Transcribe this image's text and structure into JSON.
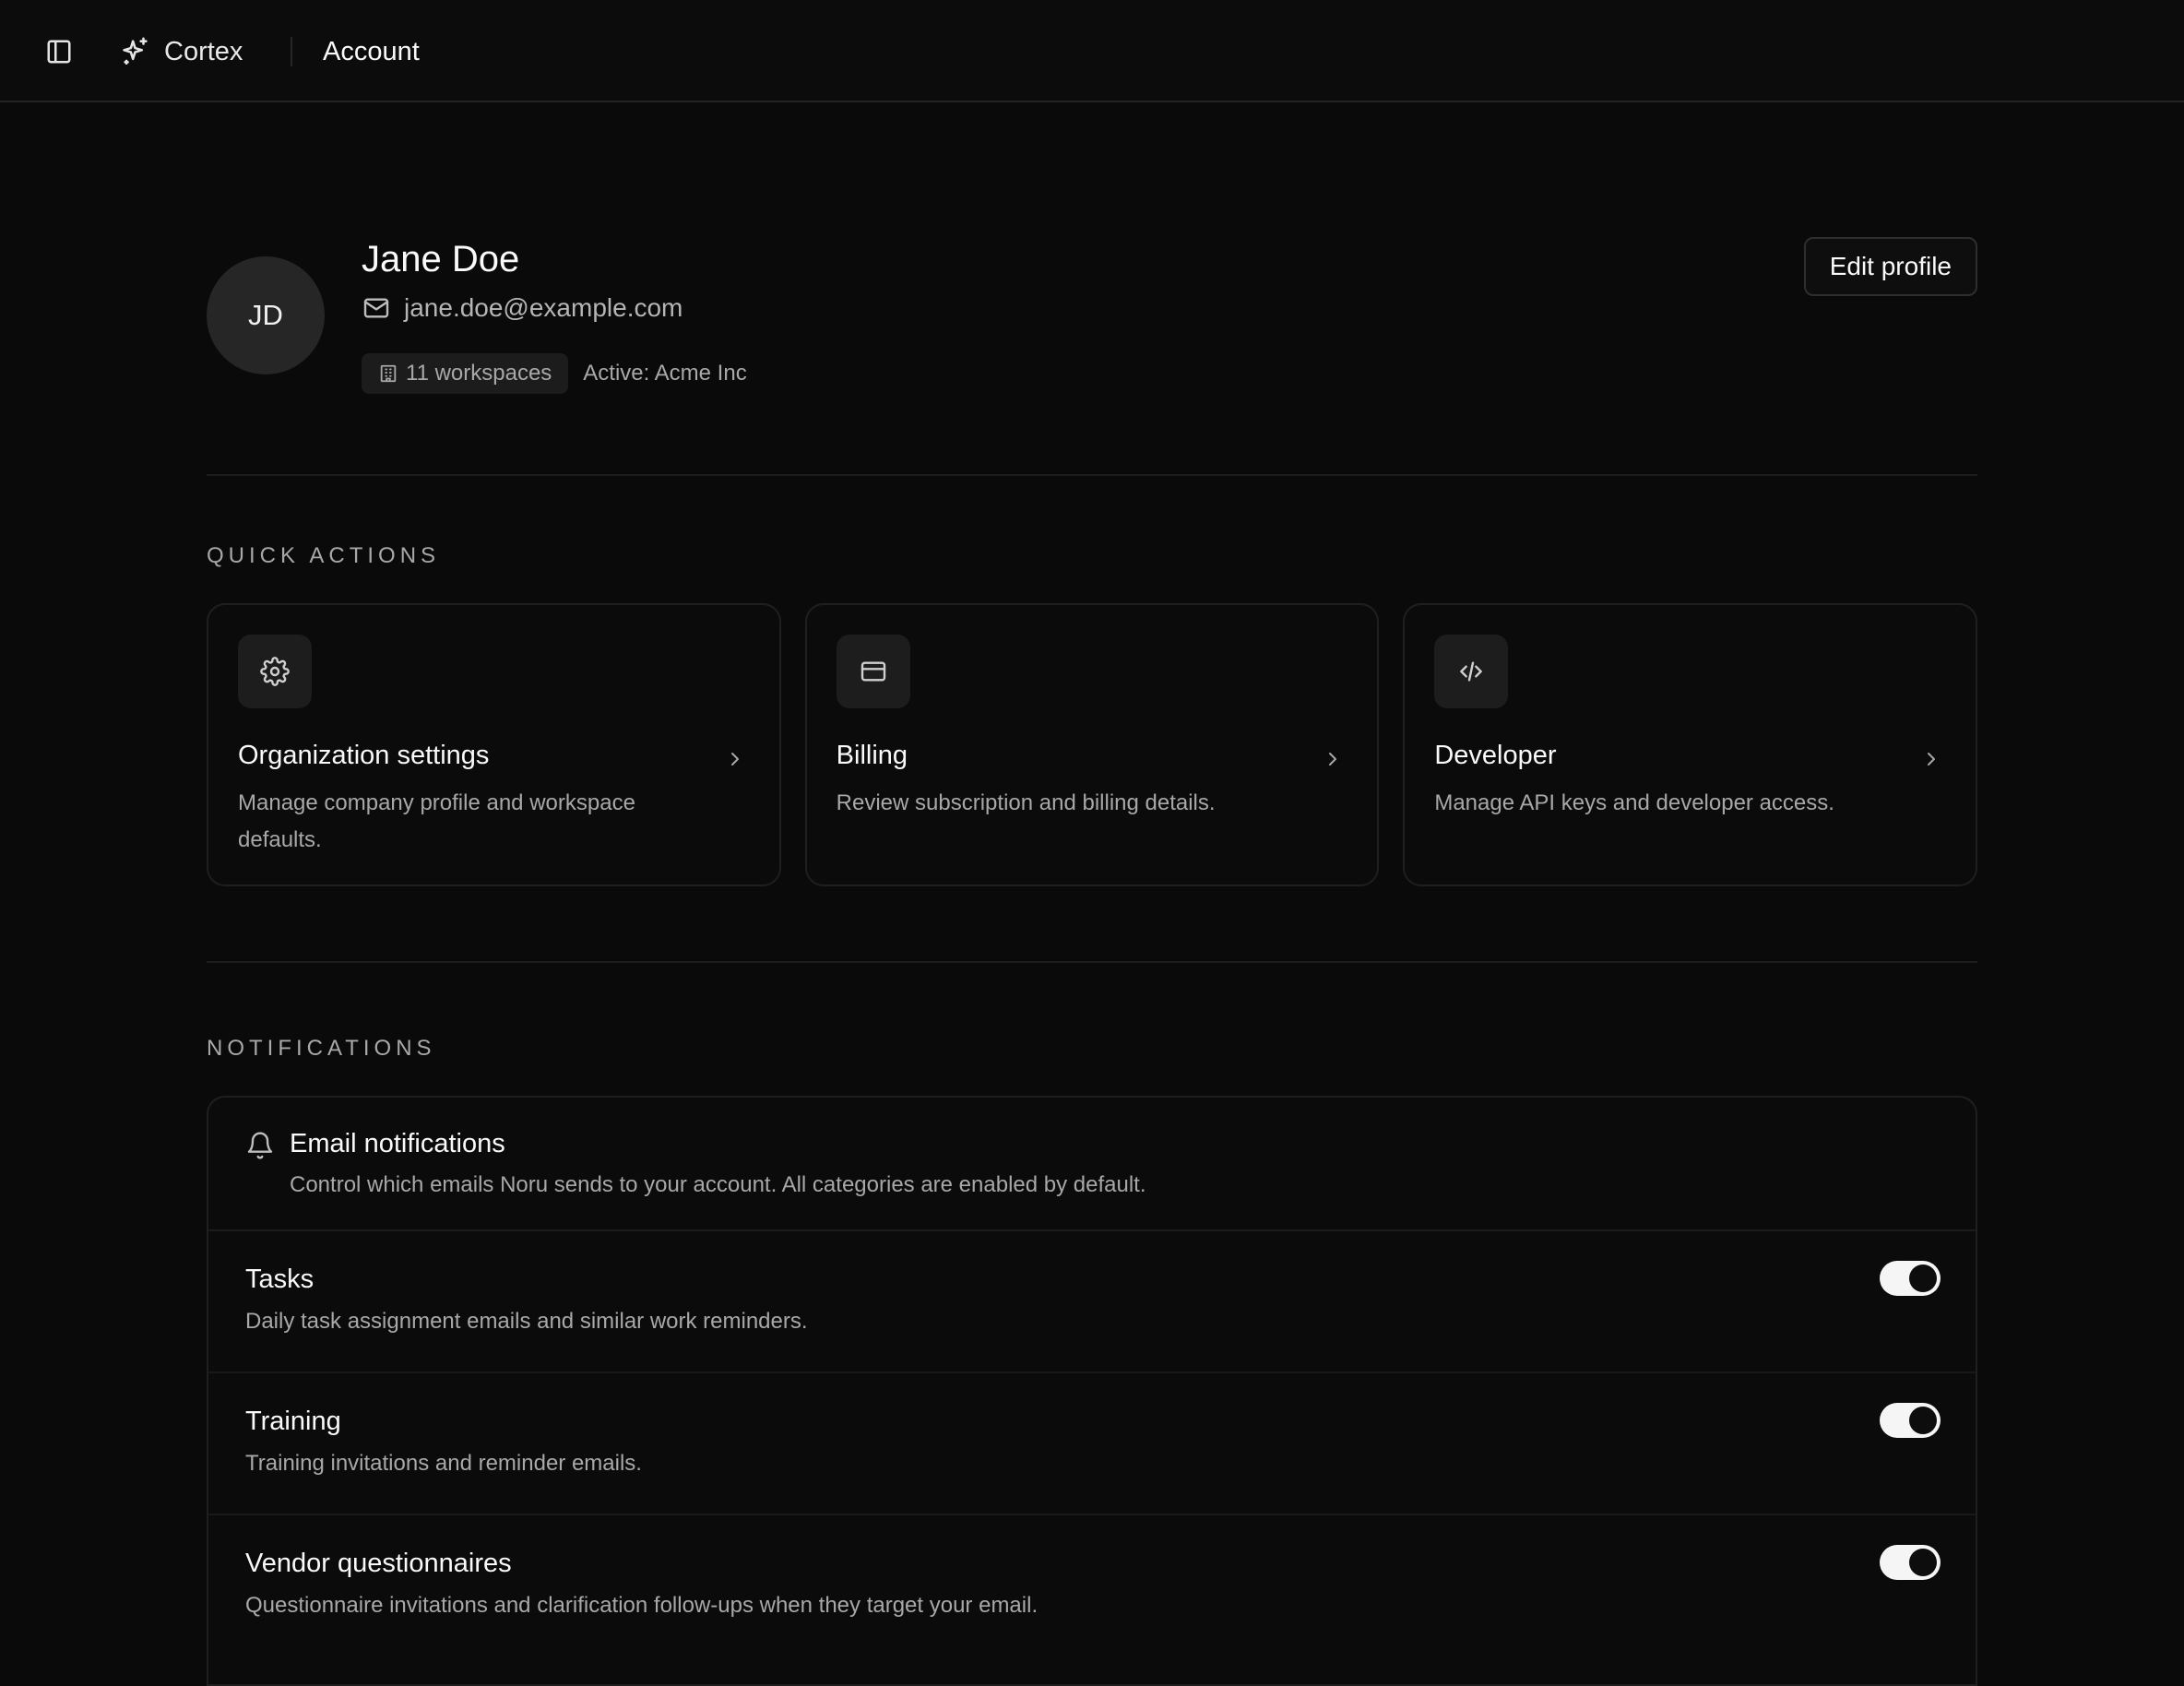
{
  "header": {
    "brand": "Cortex",
    "breadcrumb": "Account",
    "icons": {
      "sidebar_toggle": "sidebar-panel-icon",
      "brand": "sparkles-icon"
    }
  },
  "profile": {
    "initials": "JD",
    "name": "Jane Doe",
    "email": "jane.doe@example.com",
    "workspaces_badge": "11 workspaces",
    "active_workspace": "Active: Acme Inc",
    "edit_button": "Edit profile"
  },
  "quick_actions": {
    "label": "QUICK ACTIONS",
    "cards": [
      {
        "title": "Organization settings",
        "description": "Manage company profile and workspace defaults.",
        "icon": "gear-icon"
      },
      {
        "title": "Billing",
        "description": "Review subscription and billing details.",
        "icon": "credit-card-icon"
      },
      {
        "title": "Developer",
        "description": "Manage API keys and developer access.",
        "icon": "code-icon"
      }
    ]
  },
  "notifications": {
    "label": "NOTIFICATIONS",
    "email": {
      "title": "Email notifications",
      "subtitle": "Control which emails Noru sends to your account. All categories are enabled by default."
    },
    "items": [
      {
        "title": "Tasks",
        "description": "Daily task assignment emails and similar work reminders.",
        "enabled": true
      },
      {
        "title": "Training",
        "description": "Training invitations and reminder emails.",
        "enabled": true
      },
      {
        "title": "Vendor questionnaires",
        "description": "Questionnaire invitations and clarification follow-ups when they target your email.",
        "enabled": true
      }
    ]
  },
  "colors": {
    "background": "#0a0a0a",
    "surface": "#1d1d1d",
    "text": "#fafafa",
    "muted": "#a8a8a8",
    "toggle_on": "#f5f5f5"
  }
}
